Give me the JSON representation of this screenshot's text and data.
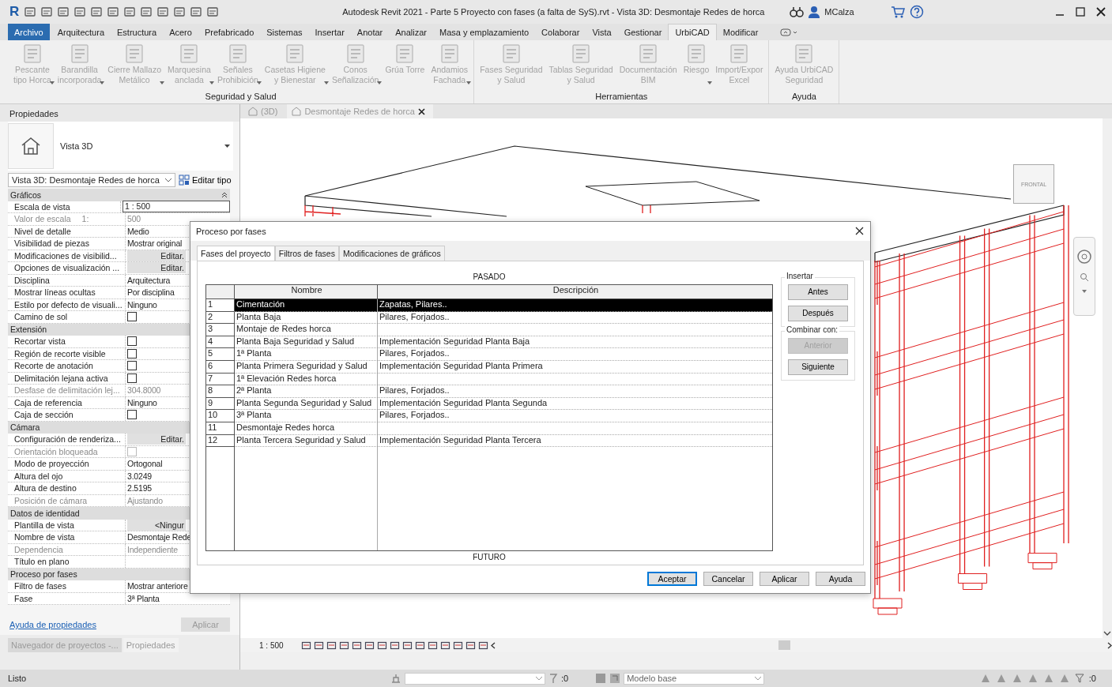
{
  "window": {
    "logo_letter": "R",
    "title": "Autodesk Revit 2021 - Parte 5 Proyecto con fases (a falta de SyS).rvt - Vista 3D: Desmontaje Redes de horca",
    "user": "MCalza"
  },
  "menu_tabs": [
    {
      "label": "Archivo",
      "kind": "file",
      "selected": false
    },
    {
      "label": "Arquitectura",
      "kind": "tab",
      "selected": false
    },
    {
      "label": "Estructura",
      "kind": "tab",
      "selected": false
    },
    {
      "label": "Acero",
      "kind": "tab",
      "selected": false
    },
    {
      "label": "Prefabricado",
      "kind": "tab",
      "selected": false
    },
    {
      "label": "Sistemas",
      "kind": "tab",
      "selected": false
    },
    {
      "label": "Insertar",
      "kind": "tab",
      "selected": false
    },
    {
      "label": "Anotar",
      "kind": "tab",
      "selected": false
    },
    {
      "label": "Analizar",
      "kind": "tab",
      "selected": false
    },
    {
      "label": "Masa y emplazamiento",
      "kind": "tab",
      "selected": false
    },
    {
      "label": "Colaborar",
      "kind": "tab",
      "selected": false
    },
    {
      "label": "Vista",
      "kind": "tab",
      "selected": false
    },
    {
      "label": "Gestionar",
      "kind": "tab",
      "selected": false
    },
    {
      "label": "UrbiCAD",
      "kind": "tab",
      "selected": true
    },
    {
      "label": "Modificar",
      "kind": "tab",
      "selected": false
    }
  ],
  "ribbon": {
    "groups": [
      {
        "title": "Seguridad y Salud",
        "buttons": [
          {
            "label": "Pescante\ntipo Horca",
            "dropdown": true,
            "disabled": true
          },
          {
            "label": "Barandilla\nincorporada",
            "dropdown": true,
            "disabled": true
          },
          {
            "label": "Cierre Mallazo\nMetálico",
            "dropdown": true,
            "disabled": true
          },
          {
            "label": "Marquesina\nanclada",
            "dropdown": true,
            "disabled": true
          },
          {
            "label": "Señales\nProhibición",
            "dropdown": true,
            "disabled": true
          },
          {
            "label": "Casetas Higiene\ny Bienestar",
            "dropdown": true,
            "disabled": true
          },
          {
            "label": "Conos\nSeñalización",
            "dropdown": true,
            "disabled": true
          },
          {
            "label": "Grúa Torre",
            "dropdown": false,
            "disabled": true
          },
          {
            "label": "Andamios\nFachada",
            "dropdown": true,
            "disabled": true
          }
        ]
      },
      {
        "title": "Herramientas",
        "buttons": [
          {
            "label": "Fases Seguridad\ny Salud",
            "dropdown": false,
            "disabled": true
          },
          {
            "label": "Tablas Seguridad\ny Salud",
            "dropdown": false,
            "disabled": true
          },
          {
            "label": "Documentación\nBIM",
            "dropdown": false,
            "disabled": true
          },
          {
            "label": "Riesgo",
            "dropdown": true,
            "disabled": true
          },
          {
            "label": "Import/Expor\nExcel",
            "dropdown": false,
            "disabled": true
          }
        ]
      },
      {
        "title": "Ayuda",
        "buttons": [
          {
            "label": "Ayuda UrbiCAD\nSeguridad",
            "dropdown": false,
            "disabled": true
          }
        ]
      }
    ]
  },
  "properties": {
    "title": "Propiedades",
    "type_name": "Vista 3D",
    "instance": "Vista 3D: Desmontaje Redes de horca",
    "edit_type": "Editar tipo",
    "groups": [
      {
        "title": "Gráficos",
        "rows": [
          {
            "label": "Escala de vista",
            "kind": "input",
            "value": "1 : 500",
            "disabled": false
          },
          {
            "label": "Valor de escala",
            "unit": "1:",
            "kind": "text",
            "value": "500",
            "disabled": true
          },
          {
            "label": "Nivel de detalle",
            "kind": "text",
            "value": "Medio",
            "disabled": false
          },
          {
            "label": "Visibilidad de piezas",
            "kind": "text",
            "value": "Mostrar original",
            "disabled": false
          },
          {
            "label": "Modificaciones de visibilid...",
            "kind": "button",
            "value": "Editar.",
            "disabled": false
          },
          {
            "label": "Opciones de visualización ...",
            "kind": "button",
            "value": "Editar.",
            "disabled": false
          },
          {
            "label": "Disciplina",
            "kind": "text",
            "value": "Arquitectura",
            "disabled": false
          },
          {
            "label": "Mostrar líneas ocultas",
            "kind": "text",
            "value": "Por disciplina",
            "disabled": false
          },
          {
            "label": "Estilo por defecto de visuali...",
            "kind": "text",
            "value": "Ninguno",
            "disabled": false
          },
          {
            "label": "Camino de sol",
            "kind": "check",
            "checked": false,
            "disabled": false
          }
        ]
      },
      {
        "title": "Extensión",
        "rows": [
          {
            "label": "Recortar vista",
            "kind": "check",
            "checked": false,
            "disabled": false
          },
          {
            "label": "Región de recorte visible",
            "kind": "check",
            "checked": false,
            "disabled": false
          },
          {
            "label": "Recorte de anotación",
            "kind": "check",
            "checked": false,
            "disabled": false
          },
          {
            "label": "Delimitación lejana activa",
            "kind": "check",
            "checked": false,
            "disabled": false
          },
          {
            "label": "Desfase de delimitación lej...",
            "kind": "text",
            "value": "304.8000",
            "disabled": true
          },
          {
            "label": "Caja de referencia",
            "kind": "text",
            "value": "Ninguno",
            "disabled": false
          },
          {
            "label": "Caja de sección",
            "kind": "check",
            "checked": false,
            "disabled": false
          }
        ]
      },
      {
        "title": "Cámara",
        "rows": [
          {
            "label": "Configuración de renderiza...",
            "kind": "button",
            "value": "Editar.",
            "disabled": false
          },
          {
            "label": "Orientación bloqueada",
            "kind": "check",
            "checked": false,
            "disabled": true
          },
          {
            "label": "Modo de proyección",
            "kind": "text",
            "value": "Ortogonal",
            "disabled": false
          },
          {
            "label": "Altura del ojo",
            "kind": "text",
            "value": "3.0249",
            "disabled": false
          },
          {
            "label": "Altura de destino",
            "kind": "text",
            "value": "2.5195",
            "disabled": false
          },
          {
            "label": "Posición de cámara",
            "kind": "text",
            "value": "Ajustando",
            "disabled": true
          }
        ]
      },
      {
        "title": "Datos de identidad",
        "rows": [
          {
            "label": "Plantilla de vista",
            "kind": "button",
            "value": "<Ningur",
            "disabled": false
          },
          {
            "label": "Nombre de vista",
            "kind": "text",
            "value": "Desmontaje Rede",
            "disabled": false
          },
          {
            "label": "Dependencia",
            "kind": "text",
            "value": "Independiente",
            "disabled": true
          },
          {
            "label": "Título en plano",
            "kind": "text",
            "disabled": false
          }
        ]
      },
      {
        "title": "Proceso por fases",
        "rows": [
          {
            "label": "Filtro de fases",
            "kind": "text",
            "value": "Mostrar anteriore",
            "disabled": false
          },
          {
            "label": "Fase",
            "kind": "text",
            "value": "3ª Planta",
            "disabled": false
          }
        ]
      }
    ],
    "help_link": "Ayuda de propiedades",
    "apply": {
      "label": "Aplicar",
      "disabled": true
    }
  },
  "panel_tabs": [
    {
      "label": "Navegador de proyectos -...",
      "selected": false
    },
    {
      "label": "Propiedades",
      "selected": true
    }
  ],
  "view_tabs": [
    {
      "label": "(3D)",
      "selected": false
    },
    {
      "label": "Desmontaje Redes de horca",
      "selected": true
    }
  ],
  "view_cube": {
    "face_label": "FRONTAL"
  },
  "view_scale": "1 : 500",
  "dialog": {
    "title": "Proceso por fases",
    "tabs": [
      {
        "label": "Fases del proyecto",
        "selected": true
      },
      {
        "label": "Filtros de fases",
        "selected": false
      },
      {
        "label": "Modificaciones de gráficos",
        "selected": false
      }
    ],
    "past_label": "PASADO",
    "future_label": "FUTURO",
    "columns": [
      "Nombre",
      "Descripción"
    ],
    "rows": [
      {
        "num": "1",
        "name": "Cimentación",
        "description": "Zapatas, Pilares..",
        "selected": true
      },
      {
        "num": "2",
        "name": "Planta Baja",
        "description": "Pilares, Forjados..",
        "selected": false
      },
      {
        "num": "3",
        "name": "Montaje de Redes horca",
        "selected": false
      },
      {
        "num": "4",
        "name": "Planta Baja Seguridad y Salud",
        "description": "Implementación Seguridad Planta Baja",
        "selected": false
      },
      {
        "num": "5",
        "name": "1ª Planta",
        "description": "Pilares, Forjados..",
        "selected": false
      },
      {
        "num": "6",
        "name": "Planta Primera Seguridad y Salud",
        "description": "Implementación Seguridad Planta Primera",
        "selected": false
      },
      {
        "num": "7",
        "name": "1ª Elevación Redes horca",
        "selected": false
      },
      {
        "num": "8",
        "name": "2ª Planta",
        "description": "Pilares, Forjados..",
        "selected": false
      },
      {
        "num": "9",
        "name": "Planta Segunda Seguridad y Salud",
        "description": "Implementación Seguridad Planta Segunda",
        "selected": false
      },
      {
        "num": "10",
        "name": "3ª Planta",
        "description": "Pilares, Forjados..",
        "selected": false
      },
      {
        "num": "11",
        "name": "Desmontaje Redes horca",
        "selected": false
      },
      {
        "num": "12",
        "name": "Planta Tercera Seguridad y Salud",
        "description": "Implementación Seguridad Planta Tercera",
        "selected": false
      }
    ],
    "insert": {
      "title": "Insertar",
      "buttons": [
        {
          "label": "Antes",
          "disabled": false
        },
        {
          "label": "Después",
          "disabled": false
        }
      ]
    },
    "combine": {
      "title": "Combinar con:",
      "buttons": [
        {
          "label": "Anterior",
          "disabled": true
        },
        {
          "label": "Siguiente",
          "disabled": false
        }
      ]
    },
    "footer_buttons": [
      {
        "label": "Aceptar",
        "default": true
      },
      {
        "label": "Cancelar",
        "default": false
      },
      {
        "label": "Aplicar",
        "default": false
      },
      {
        "label": "Ayuda",
        "default": false
      }
    ]
  },
  "status_bar": {
    "text": "Listo",
    "workset_count": ":0",
    "design_option": "Modelo base",
    "filter_count": ":0"
  }
}
